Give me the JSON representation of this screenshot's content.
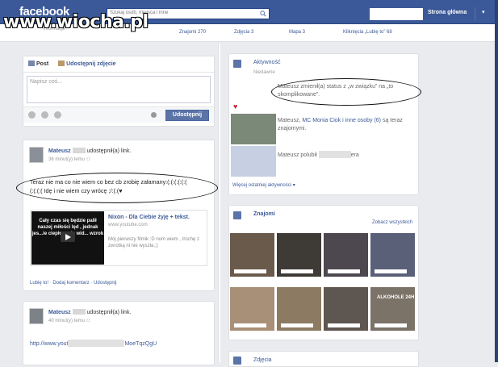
{
  "brand": {
    "logo": "facebook",
    "watermark": "www.wiocha.pl"
  },
  "search": {
    "placeholder": "Szukaj osób, miejsca i inne"
  },
  "nav": {
    "home": "Strona główna",
    "caret": "▾"
  },
  "stats": [
    {
      "label": "Informacje"
    },
    {
      "label": "Znajomi 270"
    },
    {
      "label": "Zdjęcia 3"
    },
    {
      "label": "Mapa 3"
    },
    {
      "label": "Kliknięcia „Lubię to” 68"
    }
  ],
  "composer": {
    "tab_post": "Post",
    "tab_photo": "Udostępnij zdjęcie",
    "placeholder": "Napisz coś...",
    "share": "Udostępnij"
  },
  "post1": {
    "author": "Mateusz",
    "action": "udostępnił(a) link.",
    "meta": "36 minut(y) temu",
    "text_line1": "Teraz nie ma co nie wiem co bez cb zrobię załamany:(:(:(:(:(:(",
    "text_line2": "(:(:(:( Idę i nie wiem czy wrócę ;/:(:(♥",
    "video_caption": "Cały czas się będzie palił naszej miłości lęd , jednak jes...ie ciepło , gdy wid... wzrok",
    "link_title": "Nixon - Dla Ciebie żyję + tekst.",
    "link_url": "www.youtube.com",
    "link_desc": "Mój pierwszy filmik :D nom wiem , trochę z zwrotką ni nie wyszła.;)",
    "actions": [
      "Lubię to!",
      "Dodaj komentarz",
      "Udostępnij"
    ]
  },
  "post2": {
    "author": "Mateusz",
    "action": "udostępnił(a) link.",
    "meta": "40 minut(y) temu",
    "url_start": "http://www.yout",
    "url_end": "MoeTqzQgU"
  },
  "activity": {
    "title": "Aktywność",
    "subtitle": "Niedawne",
    "item1": "Mateusz zmienił(a) status z „w związku” na „to skomplikowane”.",
    "item2_prefix": "Mateusz, ",
    "item2_link": "MC Monia Ciok i inne osoby (6)",
    "item2_suffix": " są teraz znajomymi.",
    "item3_prefix": "Mateusz polubił",
    "item3_suffix": "era",
    "more": "Więcej ostatniej aktywności"
  },
  "friends": {
    "title": "Znajomi",
    "see_all": "Zobacz wszystkich"
  },
  "photos": {
    "title": "Zdjęcia"
  },
  "photo_stamp": "ALKOHOLE 24H",
  "colors": {
    "brand": "#3b5998",
    "page_bg": "#e9ebee",
    "link": "#3b5998"
  }
}
